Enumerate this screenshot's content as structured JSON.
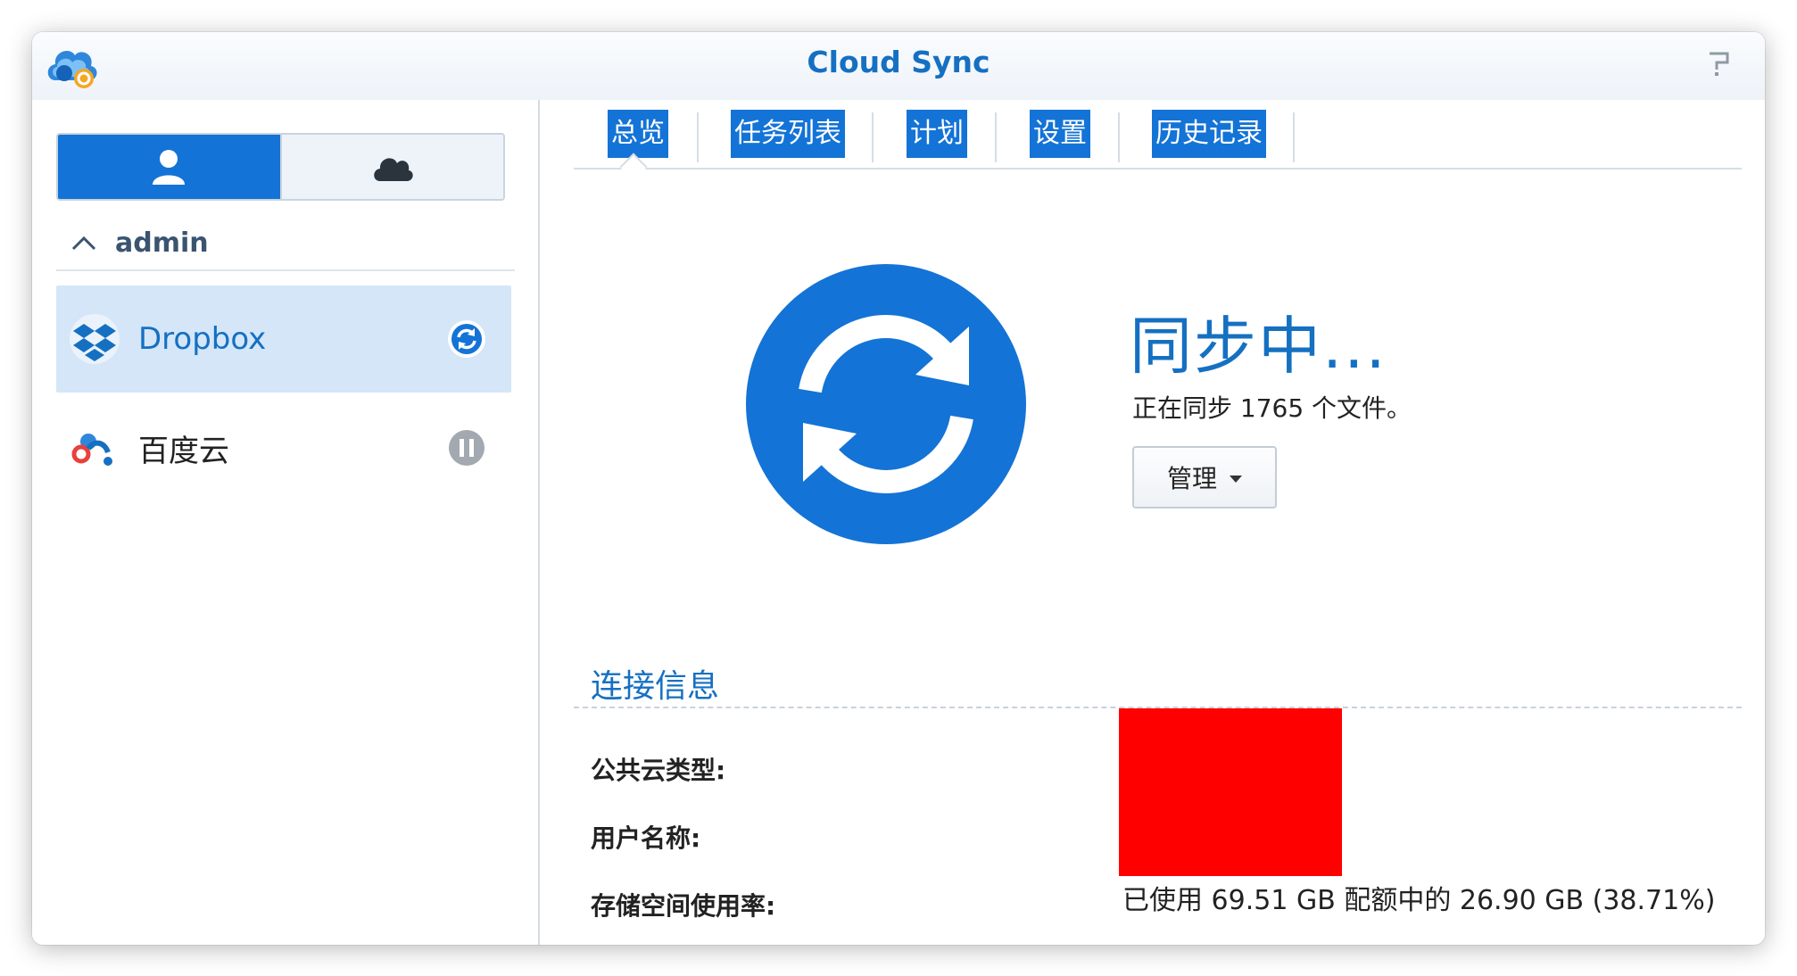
{
  "window": {
    "title": "Cloud Sync"
  },
  "sidebar": {
    "group": {
      "name": "admin"
    },
    "accounts": [
      {
        "name": "Dropbox",
        "status": "syncing",
        "selected": true
      },
      {
        "name": "百度云",
        "status": "paused",
        "selected": false
      }
    ]
  },
  "tabs": [
    "总览",
    "任务列表",
    "计划",
    "设置",
    "历史记录"
  ],
  "overview": {
    "status_title": "同步中...",
    "status_detail": "正在同步 1765 个文件。",
    "manage_label": "管理"
  },
  "connection": {
    "title": "连接信息",
    "labels": {
      "cloud_type": "公共云类型:",
      "username": "用户名称:",
      "storage": "存储空间使用率:"
    },
    "storage_usage": "已使用 69.51 GB 配额中的 26.90 GB (38.71%)"
  },
  "colors": {
    "accent": "#1473d6",
    "title_blue": "#1570c2",
    "selected_bg": "#d4e6f8",
    "redaction": "#ff0000"
  }
}
